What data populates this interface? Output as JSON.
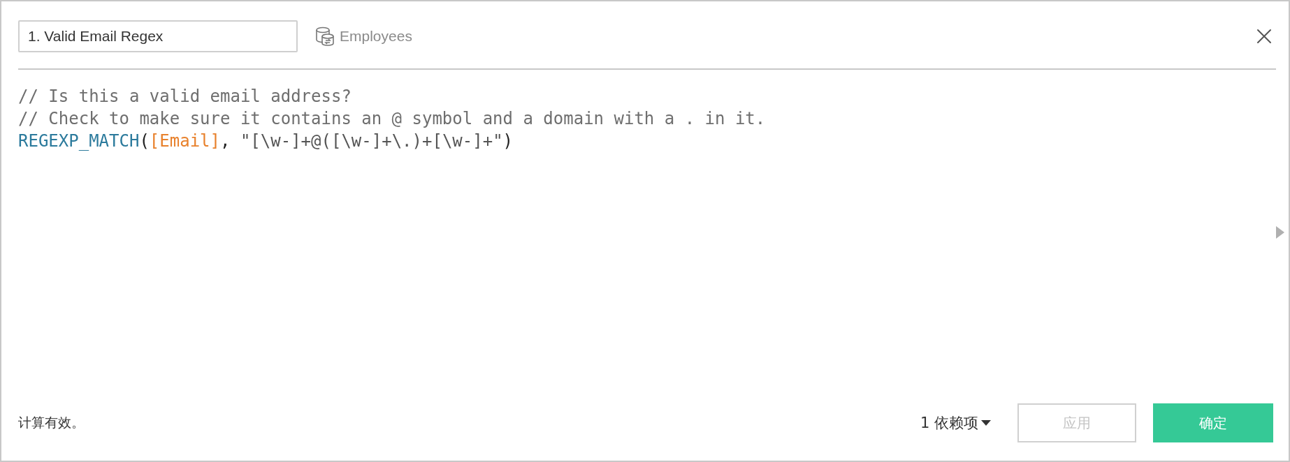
{
  "header": {
    "name_field": {
      "value": "1. Valid Email Regex"
    },
    "data_source": "Employees"
  },
  "code_lines": [
    [
      {
        "kind": "comment",
        "text": "// Is this a valid email address?"
      }
    ],
    [
      {
        "kind": "comment",
        "text": "// Check to make sure it contains an @ symbol and a domain with a . in it."
      }
    ],
    [
      {
        "kind": "function",
        "text": "REGEXP_MATCH"
      },
      {
        "kind": "punct",
        "text": "("
      },
      {
        "kind": "field",
        "text": "[Email]"
      },
      {
        "kind": "punct",
        "text": ", "
      },
      {
        "kind": "string",
        "text": "\"[\\w-]+@([\\w-]+\\.)+[\\w-]+\""
      },
      {
        "kind": "punct",
        "text": ")"
      }
    ]
  ],
  "footer": {
    "status": "计算有效。",
    "dependencies": "1 依赖项",
    "buttons": [
      {
        "label": "应用",
        "kind": "secondary",
        "disabled": true
      },
      {
        "label": "确定",
        "kind": "primary",
        "disabled": false
      }
    ]
  }
}
